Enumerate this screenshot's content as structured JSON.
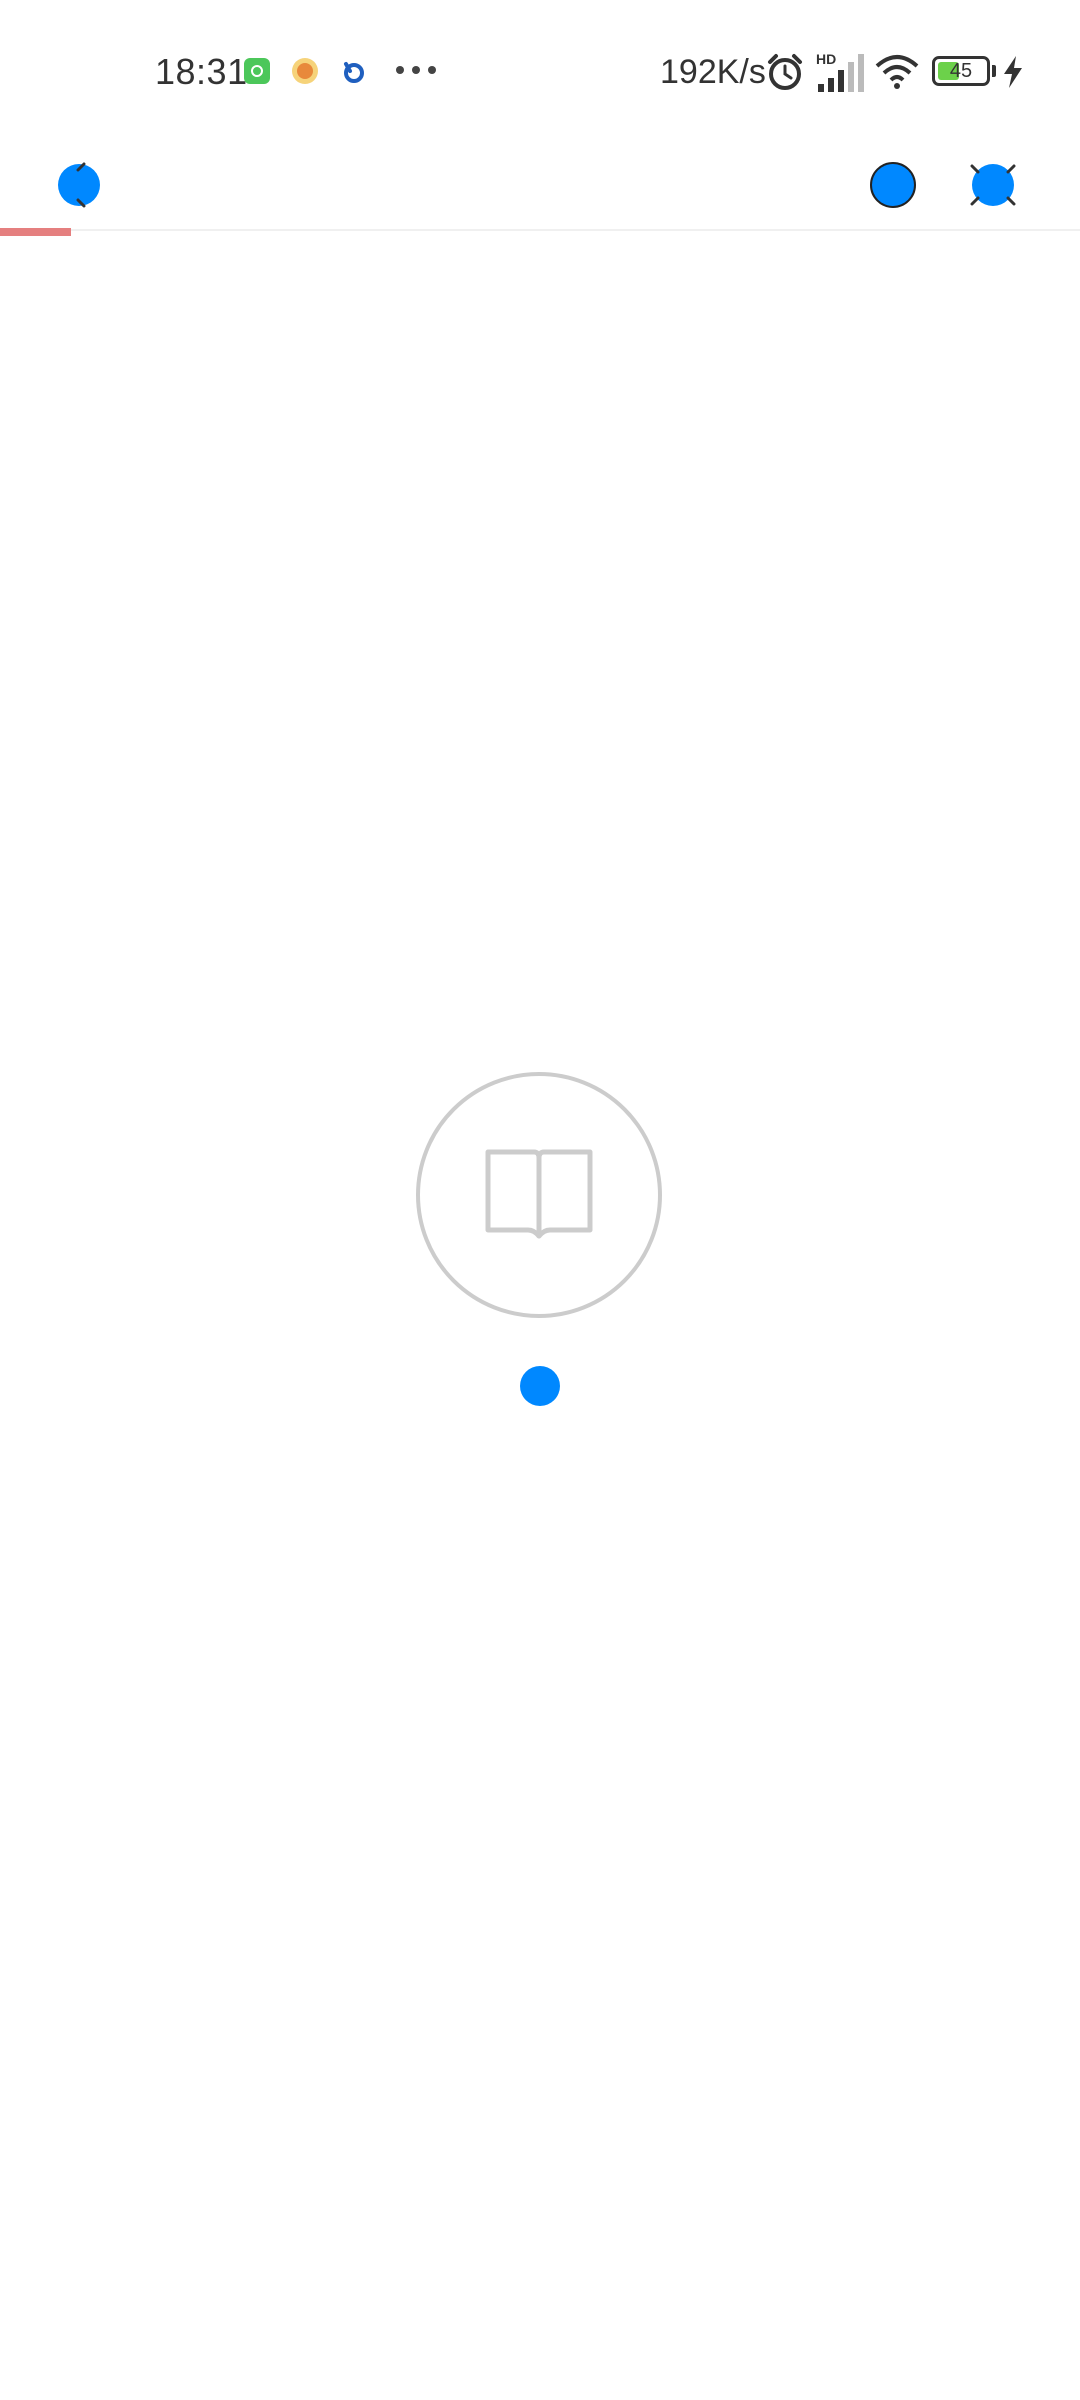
{
  "status_bar": {
    "time": "18:31",
    "network_speed": "192K/s",
    "signal_label": "HD",
    "battery_level": "45",
    "battery_fraction": 0.45,
    "icons": [
      "app-green-icon",
      "app-orange-icon",
      "app-blue-icon",
      "more-dots-icon",
      "alarm-icon",
      "signal-icon",
      "wifi-icon",
      "battery-icon",
      "charging-icon"
    ]
  },
  "app_bar": {
    "back_icon": "back-icon",
    "refresh_icon": "refresh-icon",
    "close_icon": "close-icon"
  },
  "page_load": {
    "progress_fraction": 0.066,
    "progress_color": "#e57f7f"
  },
  "content": {
    "placeholder_icon": "open-book-icon",
    "loading_indicator": "loading-dot"
  },
  "colors": {
    "accent": "#0088ff",
    "placeholder_gray": "#cccccc"
  }
}
